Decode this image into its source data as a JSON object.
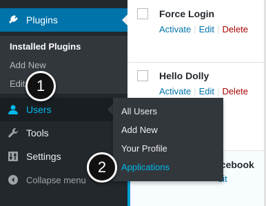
{
  "plugins": [
    {
      "name": "Force Login",
      "actions": [
        "Activate",
        "Edit",
        "Delete"
      ]
    },
    {
      "name": "Hello Dolly",
      "actions": [
        "Activate",
        "Edit",
        "Delete"
      ]
    },
    {
      "name": "acebook",
      "actions": [
        "dit"
      ]
    }
  ],
  "menu": {
    "plugins": "Plugins",
    "plugins_sub": [
      "Installed Plugins",
      "Add New",
      "Edit"
    ],
    "users": "Users",
    "tools": "Tools",
    "settings": "Settings",
    "collapse": "Collapse menu"
  },
  "flyout": [
    "All Users",
    "Add New",
    "Your Profile",
    "Applications"
  ],
  "badges": [
    "1",
    "2"
  ],
  "colors": {
    "menu_bg": "#23282d",
    "accent": "#0073aa",
    "highlight": "#00b9eb",
    "delete": "#aa0000"
  }
}
